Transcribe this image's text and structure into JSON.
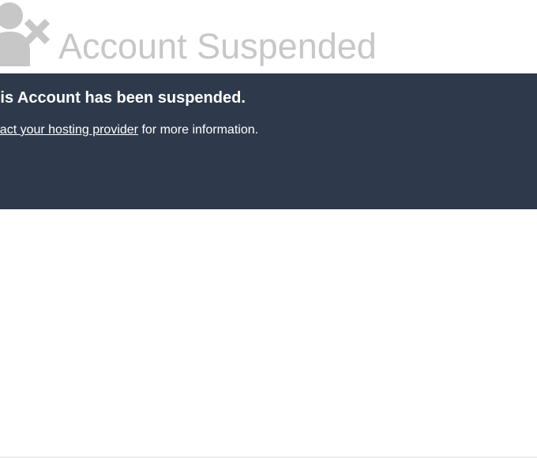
{
  "header": {
    "icon": "user-suspended-icon",
    "title": "Account Suspended"
  },
  "banner": {
    "heading": "This Account has been suspended.",
    "link_text": "Contact your hosting provider",
    "info_suffix": " for more information."
  },
  "colors": {
    "banner_background": "#2e3a4b",
    "title_text": "#c7c7c7",
    "icon": "#c7c7c7",
    "banner_text": "#ffffff"
  }
}
